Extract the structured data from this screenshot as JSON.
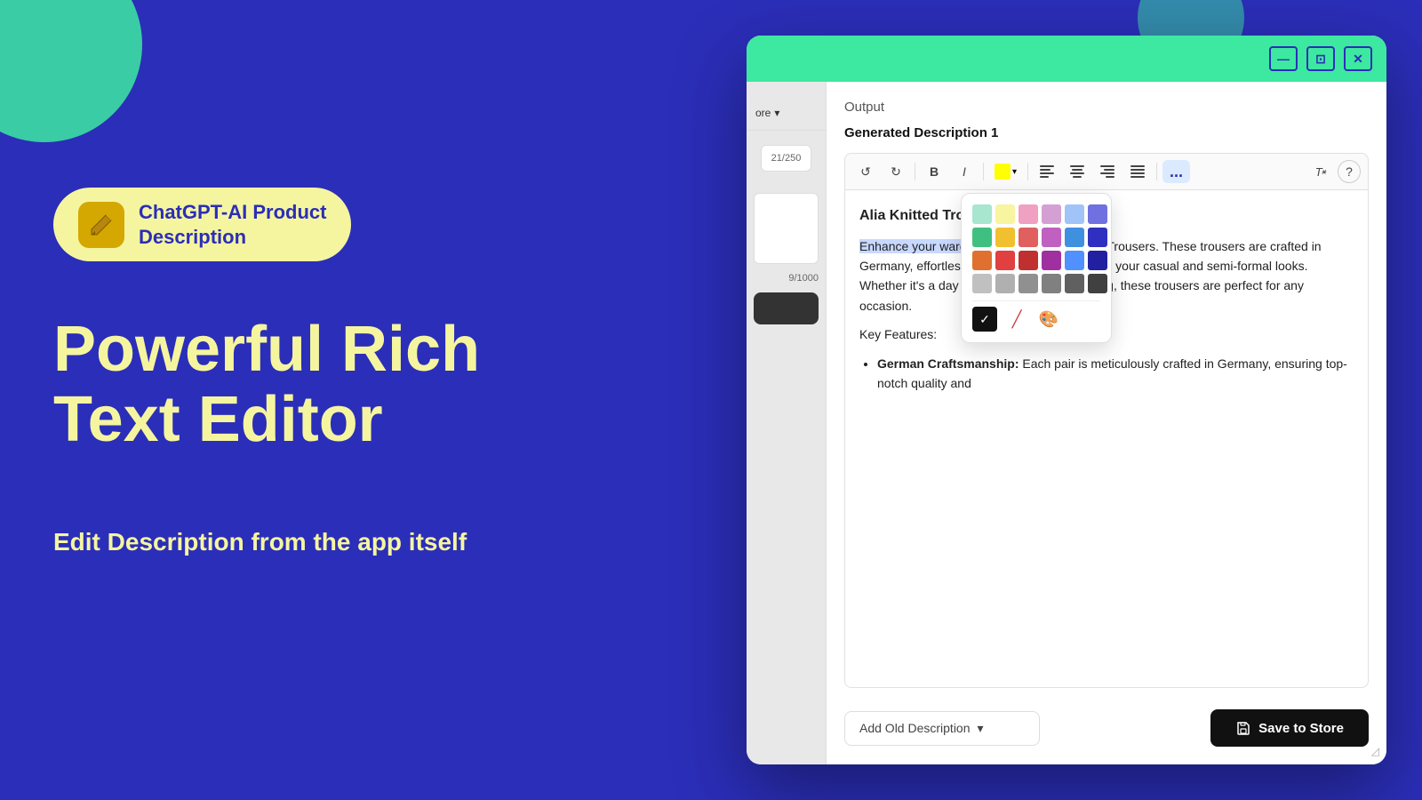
{
  "app": {
    "background_color": "#2b2eb8",
    "accent_color": "#3de8a0"
  },
  "logo": {
    "icon": "✏️",
    "title_line1": "ChatGPT-AI Product",
    "title_line2": "Description"
  },
  "hero": {
    "headline_line1": "Powerful Rich",
    "headline_line2": "Text Editor",
    "subheadline": "Edit Description from the app itself"
  },
  "window": {
    "minimize_label": "—",
    "restore_label": "⊡",
    "close_label": "✕"
  },
  "sidebar": {
    "dropdown_label": "ore",
    "char_counter": "21/250",
    "char_counter2": "9/1000"
  },
  "editor": {
    "output_label": "Output",
    "generated_title": "Generated Description 1",
    "content_heading": "Alia Knitted Trousers",
    "content_body": "Enhance your wardrobe with the Alia Knitted Trousers. These trousers are crafted in Germany, effortlessly combine style, elevating your casual and semi-formal looks. Whether it's a day out or an evening gathering, these trousers are perfect for any occasion.",
    "key_features_title": "Key Features:",
    "feature_1_title": "German Craftsmanship:",
    "feature_1_text": "Each pair is meticulously crafted in Germany, ensuring top-notch quality and",
    "toolbar": {
      "bold_label": "B",
      "italic_label": "I",
      "more_label": "...",
      "align_left": "≡",
      "align_center": "≡",
      "align_right": "≡",
      "align_justify": "≡",
      "clear_format": "Tx",
      "help": "?"
    },
    "color_picker": {
      "colors": [
        "#a8e6cf",
        "#f7f7a0",
        "#f7c0c0",
        "#d4a0d4",
        "#a0c4f7",
        "#7070e0",
        "#40c080",
        "#f0c030",
        "#e06060",
        "#c060c0",
        "#4090e0",
        "#3030c0",
        "#e07030",
        "#e04040",
        "#c03030",
        "#a030a0",
        "#5090ff",
        "#2020a0",
        "#c0c0c0",
        "#b0b0b0",
        "#909090",
        "#808080",
        "#606060",
        "#404040"
      ],
      "selected_color": "#000000"
    },
    "add_old_desc_label": "Add Old Description",
    "save_to_store_label": "Save to Store"
  }
}
